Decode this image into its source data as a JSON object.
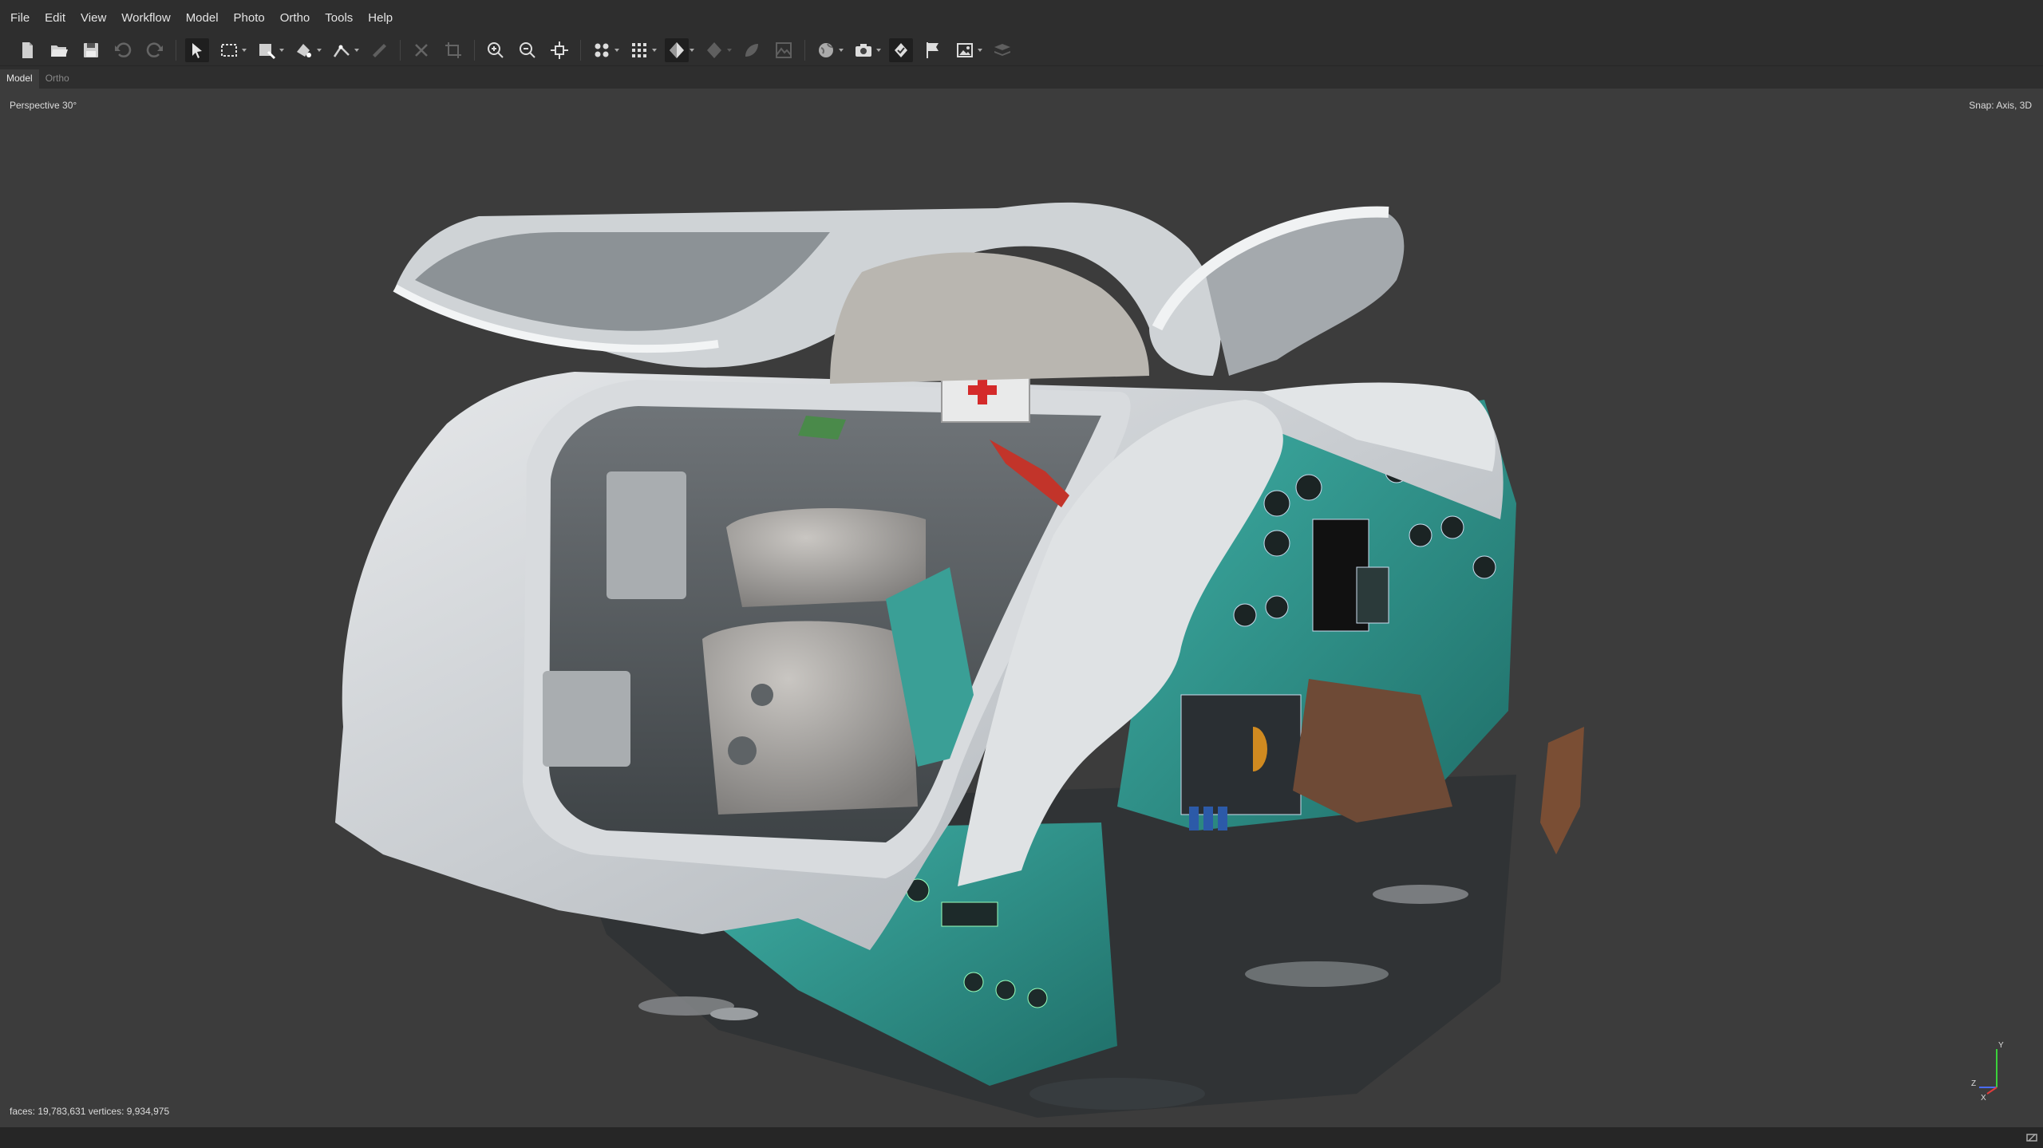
{
  "menu": [
    "File",
    "Edit",
    "View",
    "Workflow",
    "Model",
    "Photo",
    "Ortho",
    "Tools",
    "Help"
  ],
  "tabs": [
    "Model",
    "Ortho"
  ],
  "viewport": {
    "projection_label": "Perspective 30°",
    "snap_label": "Snap: Axis, 3D",
    "stats_label": "faces: 19,783,631 vertices: 9,934,975",
    "axis_labels": {
      "y": "Y",
      "z": "Z",
      "x": "X"
    }
  },
  "colors": {
    "background": "#3c3c3c",
    "chrome": "#2e2e2e",
    "axis_x": "#e23b3b",
    "axis_y": "#3bd13b",
    "axis_z": "#4a6cff"
  },
  "toolbar_icons": [
    "new-document-icon",
    "open-folder-icon",
    "save-icon",
    "undo-icon",
    "redo-icon",
    "select-icon",
    "rectangle-selection-icon",
    "draw-shape-icon",
    "draw-polygon-icon",
    "ruler-icon",
    "draw-line-icon",
    "delete-icon",
    "crop-icon",
    "zoom-in-icon",
    "zoom-out-icon",
    "reset-view-icon",
    "model-view-icon",
    "grid-icon",
    "shaded-model-icon",
    "tiled-model-icon",
    "texture-icon",
    "dem-icon",
    "globe-icon",
    "camera-icon",
    "markers-icon",
    "flag-icon",
    "image-icon",
    "layers-icon"
  ]
}
